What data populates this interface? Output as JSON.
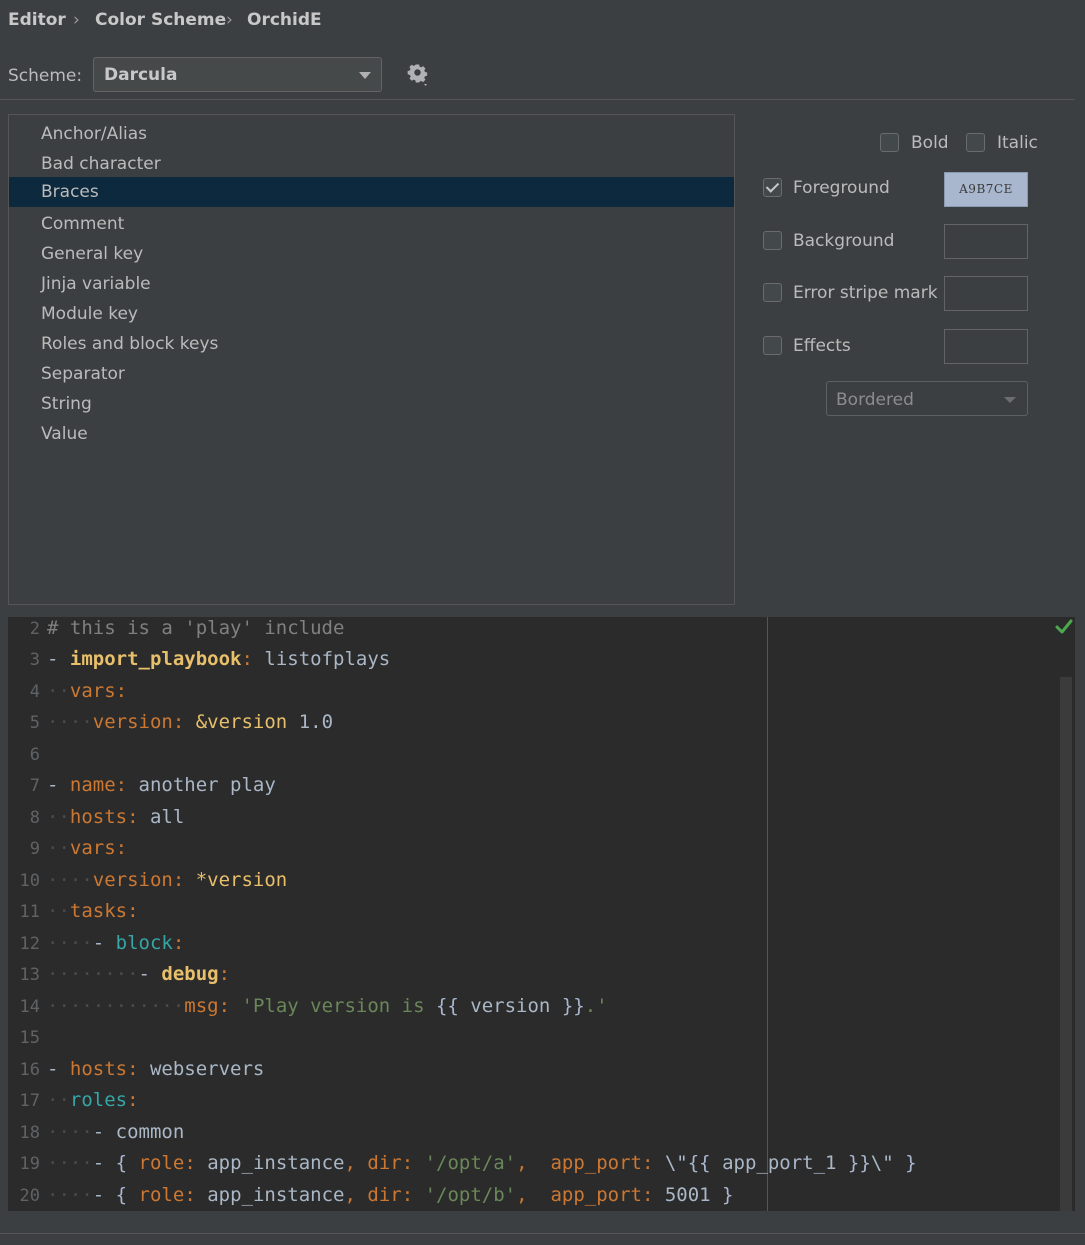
{
  "breadcrumb": {
    "items": [
      "Editor",
      "Color Scheme",
      "OrchidE"
    ],
    "separator": "›"
  },
  "scheme": {
    "label": "Scheme:",
    "selected": "Darcula"
  },
  "attributes": {
    "items": [
      "Anchor/Alias",
      "Bad character",
      "Braces",
      "Comment",
      "General key",
      "Jinja variable",
      "Module key",
      "Roles and block keys",
      "Separator",
      "String",
      "Value"
    ],
    "selected": "Braces"
  },
  "options": {
    "bold_label": "Bold",
    "italic_label": "Italic",
    "foreground_label": "Foreground",
    "foreground_value": "A9B7CE",
    "foreground_checked": true,
    "background_label": "Background",
    "error_stripe_label": "Error stripe mark",
    "effects_label": "Effects",
    "effects_type": "Bordered"
  },
  "colors": {
    "selection_bg": "#0d293e",
    "foreground_swatch": "#a9b7ce",
    "panel_bg": "#3c3f41",
    "editor_bg": "#2b2b2b",
    "ok_check": "#4ca84c"
  },
  "editor": {
    "line_numbers": [
      "2",
      "3",
      "4",
      "5",
      "6",
      "7",
      "8",
      "9",
      "10",
      "11",
      "12",
      "13",
      "14",
      "15",
      "16",
      "17",
      "18",
      "19",
      "20"
    ],
    "lines": {
      "l2": {
        "text": "# this is a 'play' include"
      },
      "l3": {
        "dash": "- ",
        "key": "import_playbook",
        "colon": ": ",
        "value": "listofplays"
      },
      "l4": {
        "key": "vars",
        "colon": ":"
      },
      "l5": {
        "key": "version",
        "colon": ": ",
        "anchor": "&version",
        "value": "1.0"
      },
      "l7": {
        "dash": "- ",
        "key": "name",
        "colon": ": ",
        "value": "another play"
      },
      "l8": {
        "key": "hosts",
        "colon": ": ",
        "value": "all"
      },
      "l9": {
        "key": "vars",
        "colon": ":"
      },
      "l10": {
        "key": "version",
        "colon": ": ",
        "alias": "*version"
      },
      "l11": {
        "key": "tasks",
        "colon": ":"
      },
      "l12": {
        "dash": "- ",
        "key": "block",
        "colon": ":"
      },
      "l13": {
        "dash": "- ",
        "key": "debug",
        "colon": ":"
      },
      "l14": {
        "key": "msg",
        "colon": ": ",
        "str1": "'Play version is ",
        "brace_open": "{{",
        "var": " version ",
        "brace_close": "}}",
        "str2": ".'"
      },
      "l16": {
        "dash": "- ",
        "key": "hosts",
        "colon": ": ",
        "value": "webservers"
      },
      "l17": {
        "key": "roles",
        "colon": ":"
      },
      "l18": {
        "dash": "- ",
        "value": "common"
      },
      "l19": {
        "dash": "- ",
        "open": "{ ",
        "k1": "role",
        "c1": ": ",
        "v1": "app_instance",
        "comma1": ", ",
        "k2": "dir",
        "c2": ": ",
        "s2": "'/opt/a'",
        "comma2": ",  ",
        "k3": "app_port",
        "c3": ": ",
        "v3a": "\\\"",
        "b1": "{{",
        "v3b": " app_port_1 ",
        "b2": "}}",
        "v3c": "\\\"",
        "close": " }"
      },
      "l20": {
        "dash": "- ",
        "open": "{ ",
        "k1": "role",
        "c1": ": ",
        "v1": "app_instance",
        "comma1": ", ",
        "k2": "dir",
        "c2": ": ",
        "s2": "'/opt/b'",
        "comma2": ",  ",
        "k3": "app_port",
        "c3": ": ",
        "v3": "5001",
        "close": " }"
      }
    }
  }
}
